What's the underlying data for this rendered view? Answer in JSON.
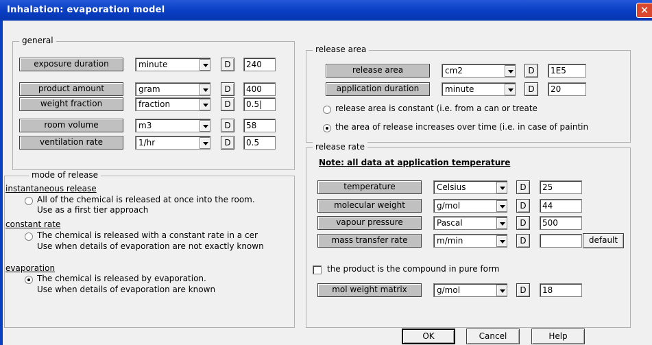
{
  "window": {
    "title": "Inhalation: evaporation model",
    "close": "✕"
  },
  "general": {
    "legend": "general",
    "rows": [
      {
        "label": "exposure duration",
        "unit": "minute",
        "d": "D",
        "value": "240"
      },
      {
        "label": "product amount",
        "unit": "gram",
        "d": "D",
        "value": "400"
      },
      {
        "label": "weight fraction",
        "unit": "fraction",
        "d": "D",
        "value": "0.5|"
      },
      {
        "label": "room volume",
        "unit": "m3",
        "d": "D",
        "value": "58"
      },
      {
        "label": "ventilation rate",
        "unit": "1/hr",
        "d": "D",
        "value": "0.5"
      }
    ]
  },
  "mode": {
    "legend": "mode of release",
    "items": [
      {
        "heading": "instantaneous release",
        "line1": "All of the chemical is released at once into the room.",
        "line2": "Use as a first tier approach",
        "selected": false
      },
      {
        "heading": "constant rate",
        "line1": "The chemical is released with a constant rate in a cer",
        "line2": "Use when details of evaporation are not exactly known",
        "selected": false
      },
      {
        "heading": "evaporation",
        "line1": "The chemical is released by evaporation.",
        "line2": "Use when details of evaporation are known",
        "selected": true
      }
    ]
  },
  "release_area": {
    "legend": "release area",
    "rows": [
      {
        "label": "release area",
        "unit": "cm2",
        "d": "D",
        "value": "1E5"
      },
      {
        "label": "application duration",
        "unit": "minute",
        "d": "D",
        "value": "20"
      }
    ],
    "options": [
      {
        "text": "release area is constant (i.e. from a can or treate",
        "selected": false
      },
      {
        "text": "the area of release increases over time (i.e. in case of paintin",
        "selected": true
      }
    ]
  },
  "release_rate": {
    "legend": "release rate",
    "note": "Note: all data at application temperature",
    "rows": [
      {
        "label": "temperature",
        "unit": "Celsius",
        "d": "D",
        "value": "25"
      },
      {
        "label": "molecular weight",
        "unit": "g/mol",
        "d": "D",
        "value": "44"
      },
      {
        "label": "vapour pressure",
        "unit": "Pascal",
        "d": "D",
        "value": "500"
      },
      {
        "label": "mass transfer rate",
        "unit": "m/min",
        "d": "D",
        "value": ""
      }
    ],
    "default_btn": "default",
    "pure_form": {
      "text": "the product is the compound in pure form",
      "checked": false
    },
    "matrix": {
      "label": "mol weight matrix",
      "unit": "g/mol",
      "d": "D",
      "value": "18"
    }
  },
  "buttons": {
    "ok": "OK",
    "cancel": "Cancel",
    "help": "Help"
  }
}
